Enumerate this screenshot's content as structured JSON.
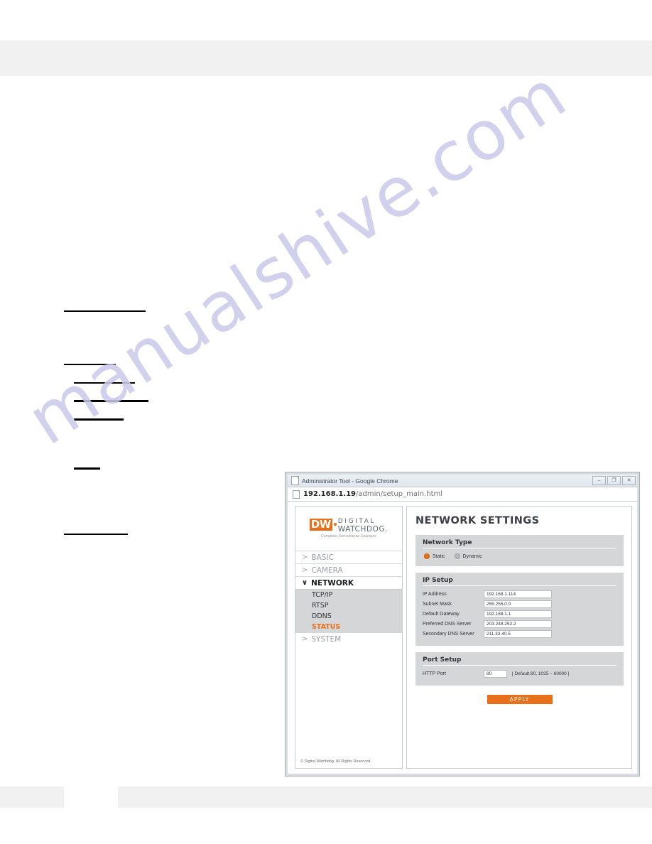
{
  "browser": {
    "title": "Administrator Tool - Google Chrome",
    "url_host": "192.168.1.19",
    "url_path": "/admin/setup_main.html",
    "window_buttons": {
      "minimize": "–",
      "maximize": "❐",
      "close": "✕"
    },
    "icons": {
      "title_doc": "document-icon",
      "address_doc": "page-icon"
    }
  },
  "sidebar": {
    "logo": {
      "mark": "DW",
      "line1": "DIGITAL",
      "line2": "WATCHDOG.",
      "tagline": "Complete Surveillance Solutions"
    },
    "items": [
      {
        "label": "BASIC",
        "caret": ">",
        "expanded": false
      },
      {
        "label": "CAMERA",
        "caret": ">",
        "expanded": false
      },
      {
        "label": "NETWORK",
        "caret": "∨",
        "expanded": true
      },
      {
        "label": "SYSTEM",
        "caret": ">",
        "expanded": false
      }
    ],
    "subitems": [
      {
        "label": "TCP/IP",
        "active": false
      },
      {
        "label": "RTSP",
        "active": false
      },
      {
        "label": "DDNS",
        "active": false
      },
      {
        "label": "STATUS",
        "active": true
      }
    ],
    "footer": "© Digital Watchdog. All Rights Reserved."
  },
  "content": {
    "title": "NETWORK SETTINGS",
    "network_type": {
      "panel_title": "Network Type",
      "options": [
        {
          "label": "Static",
          "selected": true
        },
        {
          "label": "Dynamic",
          "selected": false
        }
      ]
    },
    "ip_setup": {
      "panel_title": "IP Setup",
      "fields": [
        {
          "label": "IP Address",
          "value": "192.168.1.114"
        },
        {
          "label": "Subnet Mask",
          "value": "255.255.0.0"
        },
        {
          "label": "Default Gateway",
          "value": "192.168.1.1"
        },
        {
          "label": "Preferred DNS Server",
          "value": "203.248.252.2"
        },
        {
          "label": "Secondary DNS Server",
          "value": "211.33.40.5"
        }
      ]
    },
    "port_setup": {
      "panel_title": "Port Setup",
      "field": {
        "label": "HTTP Port",
        "value": "80"
      },
      "hint": "[ Default:80, 1025 ~ 60000 ]"
    },
    "apply_label": "APPLY"
  },
  "watermark": {
    "text": "manualshive.com"
  },
  "colors": {
    "accent": "#e8701a",
    "panel": "#d5d6d8",
    "band": "#f1f1f1",
    "watermark": "#c9caea"
  }
}
